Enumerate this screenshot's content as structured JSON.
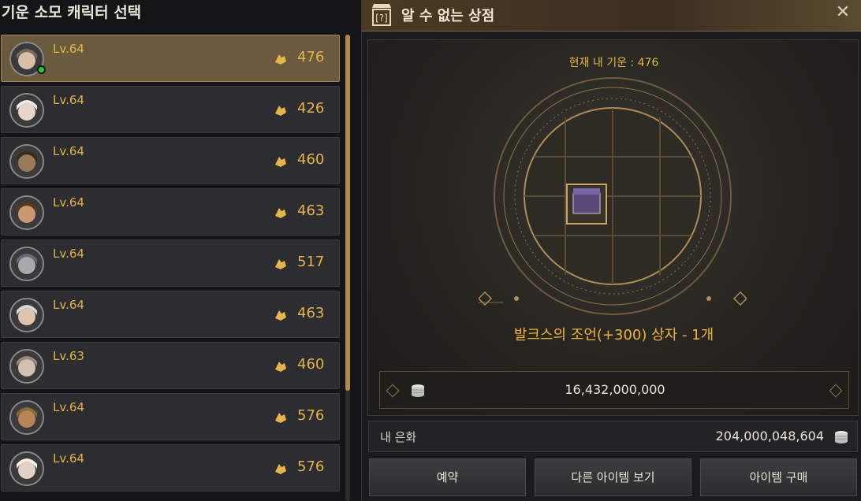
{
  "left_panel": {
    "title": "기운 소모 캐릭터 선택",
    "characters": [
      {
        "level": "Lv.64",
        "energy": "476",
        "selected": true,
        "online": true
      },
      {
        "level": "Lv.64",
        "energy": "426"
      },
      {
        "level": "Lv.64",
        "energy": "460"
      },
      {
        "level": "Lv.64",
        "energy": "463"
      },
      {
        "level": "Lv.64",
        "energy": "517"
      },
      {
        "level": "Lv.64",
        "energy": "463"
      },
      {
        "level": "Lv.63",
        "energy": "460"
      },
      {
        "level": "Lv.64",
        "energy": "576"
      },
      {
        "level": "Lv.64",
        "energy": "576"
      }
    ]
  },
  "shop": {
    "title": "알 수 없는 상점",
    "close_icon": "close-icon",
    "current_energy": "현재 내 기운 : 476",
    "item_name": "발크스의 조언(+300) 상자 - 1개",
    "price": "16,432,000,000",
    "currency_label": "내 은화",
    "currency_value": "204,000,048,604"
  },
  "buttons": {
    "reserve": "예약",
    "other_items": "다른 아이템 보기",
    "buy": "아이템 구매"
  },
  "colors": {
    "accent_gold": "#e3b54a",
    "item_orange": "#f0b43a",
    "selected_row": "#6b5a3e",
    "online_green": "#25d02a"
  }
}
